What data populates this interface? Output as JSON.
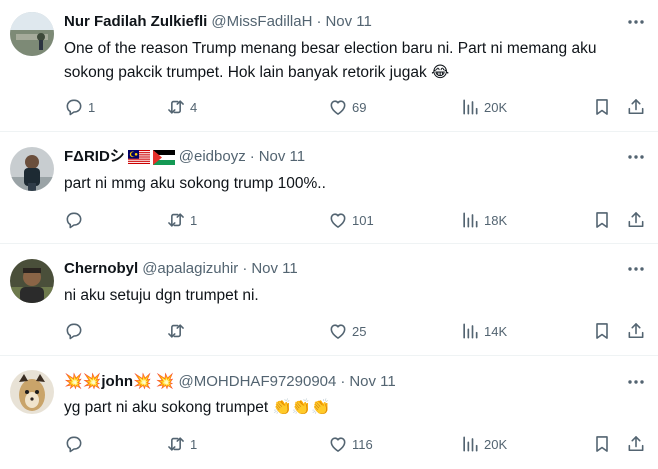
{
  "tweets": [
    {
      "name": "Nur Fadilah Zulkiefli",
      "handle": "@MissFadillaH",
      "dot": "·",
      "time": "Nov 11",
      "text": "One of the reason Trump menang besar election baru ni. Part ni memang aku sokong pakcik trumpet. Hok lain banyak retorik jugak 😂",
      "replies": "1",
      "retweets": "4",
      "likes": "69",
      "views": "20K"
    },
    {
      "name": "FΔRIDシ",
      "handle": "@eidboyz",
      "dot": "·",
      "time": "Nov 11",
      "text": "part ni mmg aku sokong trump 100%..",
      "replies": "",
      "retweets": "1",
      "likes": "101",
      "views": "18K"
    },
    {
      "name": "Chernobyl",
      "handle": "@apalagizuhir",
      "dot": "·",
      "time": "Nov 11",
      "text": "ni aku setuju dgn trumpet ni.",
      "replies": "",
      "retweets": "",
      "likes": "25",
      "views": "14K"
    },
    {
      "name_prefix": "💥💥",
      "name": " john",
      "name_suffix": "💥 💥",
      "handle": "@MOHDHAF97290904",
      "dot": "·",
      "time": "Nov 11",
      "text": "yg part ni aku sokong trumpet 👏👏👏",
      "replies": "",
      "retweets": "1",
      "likes": "116",
      "views": "20K"
    }
  ],
  "icons": {
    "reply": "reply-icon",
    "retweet": "retweet-icon",
    "like": "heart-icon",
    "views": "views-icon",
    "bookmark": "bookmark-icon",
    "share": "share-icon",
    "more": "more-icon"
  },
  "colors": {
    "text": "#0f1419",
    "muted": "#536471",
    "divider": "#eff3f4"
  }
}
